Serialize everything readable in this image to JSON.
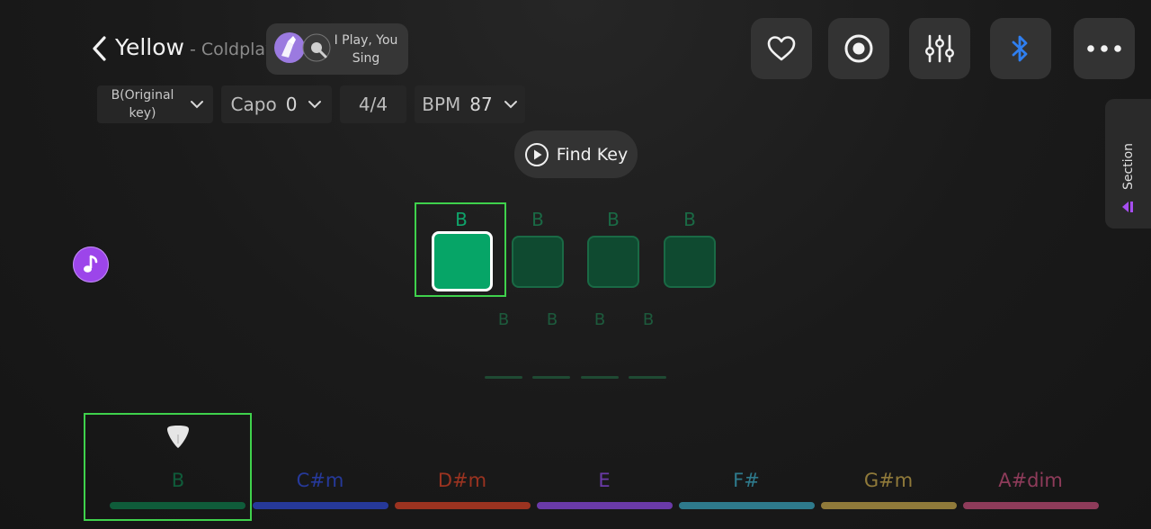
{
  "header": {
    "title": "Yellow",
    "artist": "- Coldplay",
    "mode_label": "I Play, You Sing",
    "icons": [
      "chevron-left-icon",
      "heart-icon",
      "record-icon",
      "mixer-sliders-icon",
      "bluetooth-icon",
      "more-dots-icon"
    ]
  },
  "controls": {
    "key": "B(Original key)",
    "capo_label": "Capo",
    "capo_value": "0",
    "time_signature": "4/4",
    "bpm_label": "BPM",
    "bpm_value": "87"
  },
  "find_key": {
    "label": "Find Key"
  },
  "section_tab": {
    "label": "Section"
  },
  "beats": {
    "chords": [
      "B",
      "B",
      "B",
      "B"
    ],
    "strums": [
      "B",
      "B",
      "B",
      "B"
    ],
    "active_index": 0
  },
  "chord_bar": {
    "selected_index": 0,
    "chords": [
      {
        "label": "B",
        "color": "#0f5c3a"
      },
      {
        "label": "C#m",
        "color": "#26399a"
      },
      {
        "label": "D#m",
        "color": "#9b3320"
      },
      {
        "label": "E",
        "color": "#6a3aa8"
      },
      {
        "label": "F#",
        "color": "#2e7a8c"
      },
      {
        "label": "G#m",
        "color": "#907a3a"
      },
      {
        "label": "A#dim",
        "color": "#8e3b5a"
      }
    ]
  },
  "colors": {
    "accent_green": "#3fd14c",
    "pad_active": "#06a567",
    "pad_inactive": "#0f4a30",
    "bluetooth": "#2f7ff0",
    "note_button": "#9c45ea"
  }
}
